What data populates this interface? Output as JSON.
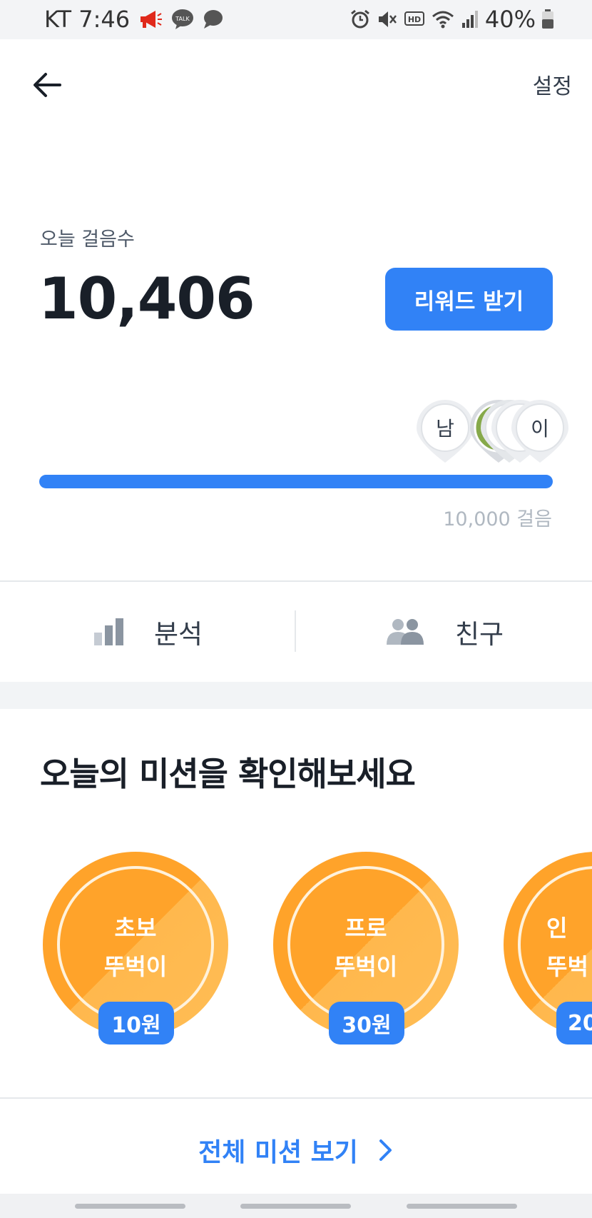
{
  "status_bar": {
    "carrier_time": "KT 7:46",
    "battery": "40%",
    "left_icons": [
      "megaphone-icon",
      "kakaotalk-icon",
      "chat-bubble-icon"
    ],
    "right_icons": [
      "alarm-icon",
      "mute-icon",
      "hd-icon",
      "wifi-icon",
      "signal-icon",
      "battery-icon"
    ]
  },
  "header": {
    "back_icon": "arrow-left-icon",
    "settings_label": "설정"
  },
  "steps": {
    "label": "오늘 걸음수",
    "count": "10,406",
    "reward_button": "리워드 받기",
    "progress_fraction": 1.0,
    "goal_label": "10,000 걸음",
    "friend_pins": [
      "남",
      "이"
    ]
  },
  "tabs": [
    {
      "label": "분석",
      "icon": "bar-chart-icon"
    },
    {
      "label": "친구",
      "icon": "people-icon"
    }
  ],
  "missions": {
    "title": "오늘의 미션을 확인해보세요",
    "items": [
      {
        "line1": "초보",
        "line2": "뚜벅이",
        "reward": "10원"
      },
      {
        "line1": "프로",
        "line2": "뚜벅이",
        "reward": "30원"
      },
      {
        "line1": "인",
        "line2": "뚜벅",
        "reward": "20"
      }
    ],
    "all_link": "전체 미션 보기"
  },
  "colors": {
    "accent": "#3182f6",
    "medal": "#ffa32a"
  }
}
